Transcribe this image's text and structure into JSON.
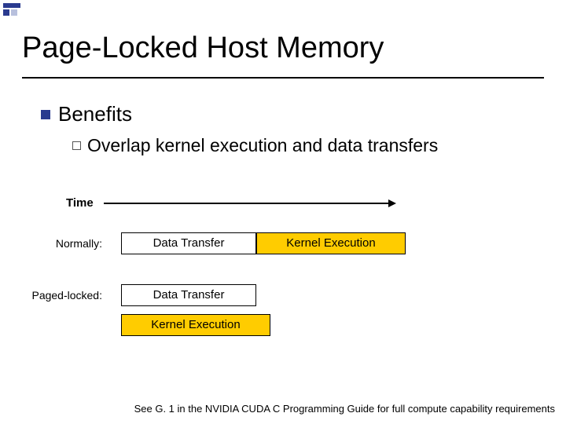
{
  "title": "Page-Locked Host Memory",
  "bullets": {
    "l1": "Benefits",
    "l2": "Overlap kernel execution and data transfers"
  },
  "time_label": "Time",
  "rows": {
    "normally": "Normally:",
    "paged": "Paged-locked:"
  },
  "boxes": {
    "data_transfer": "Data Transfer",
    "kernel_exec": "Kernel Execution"
  },
  "footnote": "See G. 1 in the NVIDIA CUDA C Programming Guide for full compute capability requirements"
}
